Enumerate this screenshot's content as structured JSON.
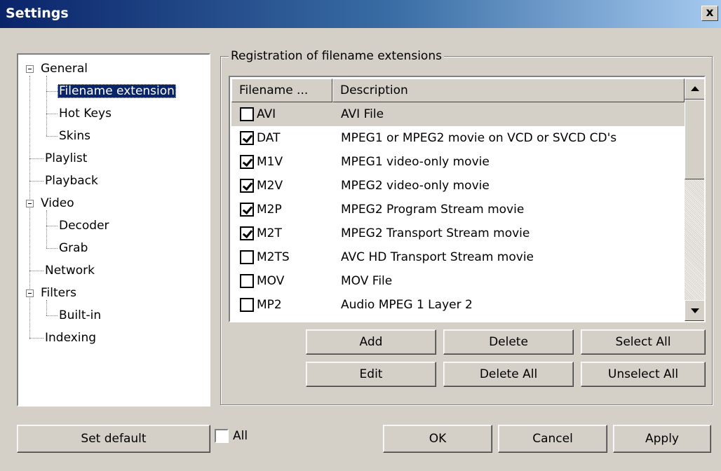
{
  "window": {
    "title": "Settings",
    "close_label": "x"
  },
  "tree": {
    "items": [
      {
        "label": "General",
        "level": 0,
        "expanded": true
      },
      {
        "label": "Filename extension",
        "level": 1,
        "selected": true
      },
      {
        "label": "Hot Keys",
        "level": 1
      },
      {
        "label": "Skins",
        "level": 1
      },
      {
        "label": "Playlist",
        "level": 0
      },
      {
        "label": "Playback",
        "level": 0
      },
      {
        "label": "Video",
        "level": 0,
        "expanded": true
      },
      {
        "label": "Decoder",
        "level": 1
      },
      {
        "label": "Grab",
        "level": 1
      },
      {
        "label": "Network",
        "level": 0
      },
      {
        "label": "Filters",
        "level": 0,
        "expanded": true
      },
      {
        "label": "Built-in",
        "level": 1
      },
      {
        "label": "Indexing",
        "level": 0
      }
    ]
  },
  "group": {
    "title": "Registration of filename extensions"
  },
  "table": {
    "columns": [
      "Filename ...",
      "Description"
    ],
    "rows": [
      {
        "checked": false,
        "ext": "AVI",
        "desc": "AVI File"
      },
      {
        "checked": true,
        "ext": "DAT",
        "desc": "MPEG1 or MPEG2 movie on VCD or SVCD CD's"
      },
      {
        "checked": true,
        "ext": "M1V",
        "desc": "MPEG1 video-only movie"
      },
      {
        "checked": true,
        "ext": "M2V",
        "desc": "MPEG2 video-only movie"
      },
      {
        "checked": true,
        "ext": "M2P",
        "desc": "MPEG2 Program Stream movie"
      },
      {
        "checked": true,
        "ext": "M2T",
        "desc": "MPEG2 Transport Stream movie"
      },
      {
        "checked": false,
        "ext": "M2TS",
        "desc": "AVC HD Transport Stream movie"
      },
      {
        "checked": false,
        "ext": "MOV",
        "desc": "MOV File"
      },
      {
        "checked": false,
        "ext": "MP2",
        "desc": "Audio MPEG 1 Layer 2"
      }
    ]
  },
  "buttons": {
    "add": "Add",
    "delete": "Delete",
    "select_all": "Select All",
    "edit": "Edit",
    "delete_all": "Delete All",
    "unselect_all": "Unselect All",
    "set_default": "Set default",
    "ok": "OK",
    "cancel": "Cancel",
    "apply": "Apply"
  },
  "all_checkbox": {
    "label": "All",
    "checked": false
  },
  "colors": {
    "face": "#d4d0c8",
    "titlebar_start": "#0a246a",
    "titlebar_end": "#a6caf0",
    "selection": "#0a246a"
  }
}
